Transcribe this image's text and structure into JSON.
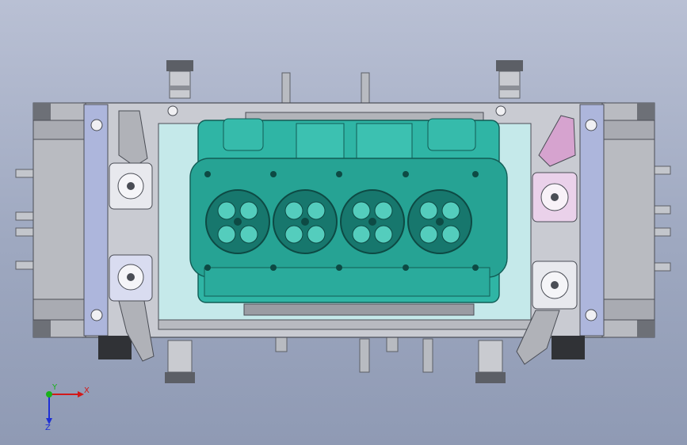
{
  "viewport": {
    "background_top": "#b9c0d4",
    "background_bottom": "#8f9ab4"
  },
  "model": {
    "part": "cylinder-head-fixture",
    "colors": {
      "cylinder_head": "#2fb5a5",
      "cylinder_head_dark": "#17776d",
      "base_plate": "#c9cbd2",
      "rail": "#adb6dc",
      "frame_gray": "#9a9ca3",
      "dark_block": "#303236",
      "pink_bracket": "#d6a3cf",
      "clamp_white": "#e8e9ee",
      "tray": "#c5e9ea"
    },
    "bores": 4
  },
  "triad": {
    "x_label": "X",
    "y_label": "Y",
    "z_label": "Z",
    "x_color": "#d11919",
    "y_color": "#19b219",
    "z_color": "#1d2fd6"
  }
}
